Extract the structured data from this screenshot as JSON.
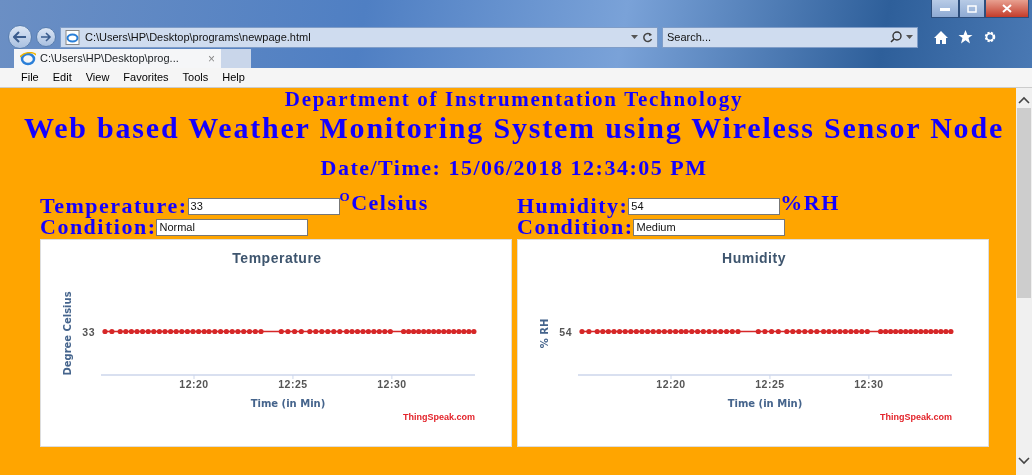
{
  "browser": {
    "address": "C:\\Users\\HP\\Desktop\\programs\\newpage.html",
    "search": {
      "placeholder": "Search..."
    },
    "tabs": [
      {
        "label": "C:\\Users\\HP\\Desktop\\prog...",
        "selected": true,
        "close": "×"
      }
    ],
    "menu": [
      "File",
      "Edit",
      "View",
      "Favorites",
      "Tools",
      "Help"
    ]
  },
  "page": {
    "department": "Department of Instrumentation Technology",
    "title": "Web based Weather Monitoring System using Wireless Sensor Node",
    "datetime": "Date/Time: 15/06/2018 12:34:05 PM",
    "panels": [
      {
        "label": "Temperature:",
        "value": "33",
        "unit": "$^{O}$Celsius",
        "condition_label": "Condition:",
        "condition": "Normal",
        "chart": {
          "title": "Temperature",
          "ylabel": "Degree Celsius",
          "y_tick": "33",
          "x_ticks": [
            "12:20",
            "12:25",
            "12:30"
          ],
          "xlabel": "Time (in Min)",
          "credit": "ThingSpeak.com"
        }
      },
      {
        "label": "Humidity:",
        "value": "54",
        "unit": "%RH",
        "condition_label": "Condition:",
        "condition": "Medium",
        "chart": {
          "title": "Humidity",
          "ylabel": "% RH",
          "y_tick": "54",
          "x_ticks": [
            "12:20",
            "12:25",
            "12:30"
          ],
          "xlabel": "Time (in Min)",
          "credit": "ThingSpeak.com"
        }
      }
    ]
  }
}
